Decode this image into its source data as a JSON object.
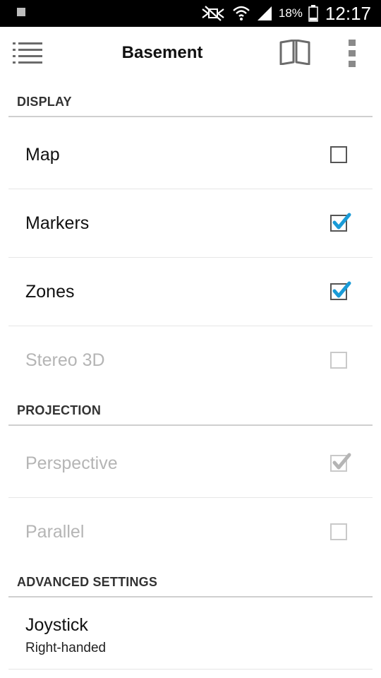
{
  "status_bar": {
    "battery_percent": "18%",
    "time": "12:17",
    "icons": [
      "notification-icon",
      "nfc-muted-icon",
      "wifi-icon",
      "signal-icon",
      "battery-icon"
    ]
  },
  "toolbar": {
    "title": "Basement",
    "icons": [
      "list-menu-icon",
      "book-icon",
      "overflow-menu-icon"
    ]
  },
  "sections": {
    "display": {
      "header": "DISPLAY",
      "items": [
        {
          "label": "Map",
          "checked": false,
          "enabled": true
        },
        {
          "label": "Markers",
          "checked": true,
          "enabled": true
        },
        {
          "label": "Zones",
          "checked": true,
          "enabled": true
        },
        {
          "label": "Stereo 3D",
          "checked": false,
          "enabled": false
        }
      ]
    },
    "projection": {
      "header": "PROJECTION",
      "items": [
        {
          "label": "Perspective",
          "checked": true,
          "enabled": false
        },
        {
          "label": "Parallel",
          "checked": false,
          "enabled": false
        }
      ]
    },
    "advanced": {
      "header": "ADVANCED SETTINGS",
      "items": [
        {
          "label": "Joystick",
          "summary": "Right-handed"
        }
      ]
    }
  },
  "colors": {
    "status_bar_bg": "#000000",
    "check_accent": "#1a9bd7",
    "disabled_text": "#b5b5b5",
    "divider": "#cfcfcf"
  }
}
